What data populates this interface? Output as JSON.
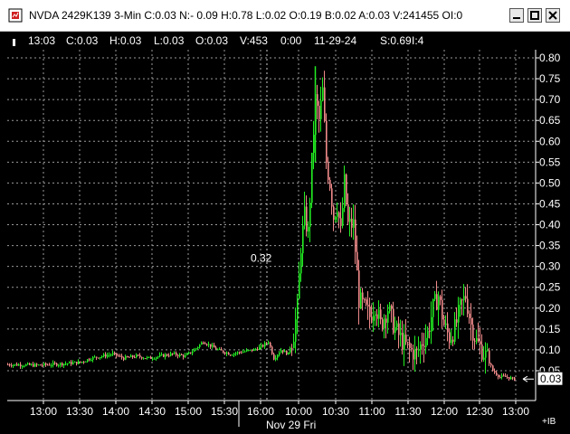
{
  "window": {
    "title": "NVDA 2429K139 3-Min C:0.03 N:- 0.09 H:0.78 L:0.02 O:0.19 B:0.02 A:0.03 V:241455 OI:0",
    "icon": "chart-window-icon"
  },
  "infobar": {
    "time": "13:03",
    "close": "C:0.03",
    "high": "H:0.03",
    "low": "L:0.03",
    "open": "O:0.03",
    "volume": "V:453",
    "elapsed": "0:00",
    "date": "11-29-24",
    "s": "S:0.69",
    "i": "I:4"
  },
  "colors": {
    "up": "#22ee22",
    "down": "#f08a8a",
    "grid": "#9a9a9a",
    "text": "#ffffff",
    "background": "#000000"
  },
  "crosshair": {
    "label": "0.32"
  },
  "last_price": {
    "label": "0.03"
  },
  "scroll_marker": "+IB",
  "chart_data": {
    "type": "candlestick",
    "y_ticks": [
      "0.80",
      "0.75",
      "0.70",
      "0.65",
      "0.60",
      "0.55",
      "0.50",
      "0.45",
      "0.40",
      "0.35",
      "0.30",
      "0.25",
      "0.20",
      "0.15",
      "0.10",
      "0.05"
    ],
    "ylim": [
      0.0,
      0.82
    ],
    "x_ticks": [
      "13:00",
      "13:30",
      "14:00",
      "14:30",
      "15:00",
      "15:30",
      "16:00",
      "10:00",
      "10:30",
      "11:00",
      "11:30",
      "12:00",
      "12:30",
      "13:00"
    ],
    "x_sublabel": "Nov 29 Fri",
    "sessions": [
      "Nov 28 13:00-16:00",
      "Nov 29 09:30-13:03"
    ],
    "series": [
      {
        "period": "Nov 28 12:45-14:00",
        "close_range": [
          0.06,
          0.07
        ]
      },
      {
        "period": "Nov 28 14:00-15:30",
        "close_range": [
          0.07,
          0.1
        ]
      },
      {
        "period": "Nov 28 15:30-16:00",
        "close_range": [
          0.08,
          0.13
        ]
      },
      {
        "period": "Nov 29 09:30-10:00",
        "close_range": [
          0.1,
          0.4
        ],
        "high": 0.45
      },
      {
        "period": "Nov 29 10:00-10:30",
        "close_range": [
          0.5,
          0.75
        ],
        "high": 0.78
      },
      {
        "period": "Nov 29 10:30-11:00",
        "close_range": [
          0.2,
          0.5
        ]
      },
      {
        "period": "Nov 29 11:00-11:30",
        "close_range": [
          0.12,
          0.22
        ]
      },
      {
        "period": "Nov 29 11:30-12:00",
        "close_range": [
          0.08,
          0.2
        ]
      },
      {
        "period": "Nov 29 12:00-12:30",
        "close_range": [
          0.1,
          0.25
        ]
      },
      {
        "period": "Nov 29 12:30-13:03",
        "close_range": [
          0.03,
          0.12
        ],
        "close": 0.03
      }
    ],
    "grid": true
  }
}
